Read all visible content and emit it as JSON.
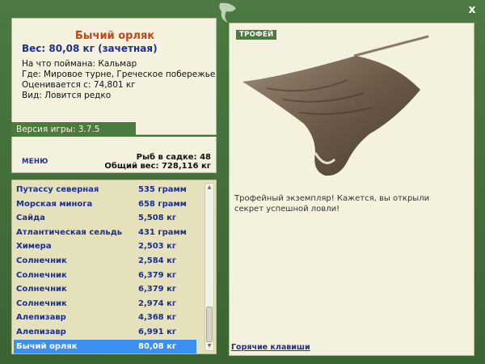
{
  "window": {
    "close_label": "x"
  },
  "fish": {
    "title": "Бычий орляк",
    "weight": "Вес: 80,08 кг (зачетная)",
    "bait": "На что поймана: Кальмар",
    "location": "Где: Мировое турне, Греческое побережье",
    "value": "Оценивается с: 74,801 кг",
    "type": "Вид: Ловится редко"
  },
  "version": "Версия игры: 3.7.5",
  "menu": {
    "label": "МЕНЮ"
  },
  "stats": {
    "keepnet": "Рыб в садке: 48",
    "total_weight": "Общий вес: 728,116 кг"
  },
  "catch_list": [
    {
      "name": "Путассу северная",
      "weight": "535 грамм"
    },
    {
      "name": "Морская минога",
      "weight": "658 грамм"
    },
    {
      "name": "Сайда",
      "weight": "5,508 кг"
    },
    {
      "name": "Атлантическая сельдь",
      "weight": "431 грамм"
    },
    {
      "name": "Химера",
      "weight": "2,503 кг"
    },
    {
      "name": "Солнечник",
      "weight": "2,584 кг"
    },
    {
      "name": "Солнечник",
      "weight": "6,379 кг"
    },
    {
      "name": "Солнечник",
      "weight": "6,379 кг"
    },
    {
      "name": "Солнечник",
      "weight": "2,974 кг"
    },
    {
      "name": "Алепизавр",
      "weight": "4,368 кг"
    },
    {
      "name": "Алепизавр",
      "weight": "6,991 кг"
    },
    {
      "name": "Бычий орляк",
      "weight": "80,08 кг"
    }
  ],
  "selected_index": 11,
  "trophy": {
    "label": "ТРОФЕЙ",
    "text": "Трофейный экземпляр! Кажется, вы открыли секрет успешной ловли!"
  },
  "hotkeys": {
    "label": "Горячие клавиши"
  },
  "icons": {
    "close": "close-icon",
    "emblem": "fish-emblem-icon",
    "scroll_up": "arrow-up-icon",
    "scroll_down": "arrow-down-icon"
  },
  "colors": {
    "frame": "#3f6a37",
    "panel": "#f4f2df",
    "list_bg": "#e5e2bb",
    "title": "#c0461a",
    "text_blue": "#1d2e8c",
    "selected": "#3a8ff0"
  }
}
